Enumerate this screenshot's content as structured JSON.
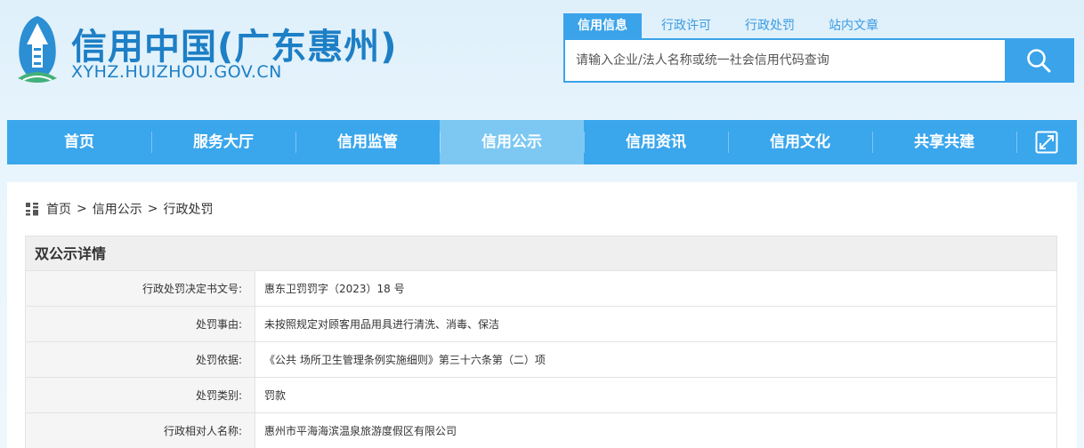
{
  "header": {
    "title": "信用中国(广东惠州)",
    "url": "XYHZ.HUIZHOU.GOV.CN"
  },
  "search": {
    "tabs": [
      {
        "label": "信用信息",
        "active": true
      },
      {
        "label": "行政许可",
        "active": false
      },
      {
        "label": "行政处罚",
        "active": false
      },
      {
        "label": "站内文章",
        "active": false
      }
    ],
    "placeholder": "请输入企业/法人名称或统一社会信用代码查询"
  },
  "nav": {
    "items": [
      {
        "label": "首页",
        "active": false
      },
      {
        "label": "服务大厅",
        "active": false
      },
      {
        "label": "信用监管",
        "active": false
      },
      {
        "label": "信用公示",
        "active": true
      },
      {
        "label": "信用资讯",
        "active": false
      },
      {
        "label": "信用文化",
        "active": false
      },
      {
        "label": "共享共建",
        "active": false
      }
    ]
  },
  "breadcrumb": {
    "home": "首页",
    "section": "信用公示",
    "current": "行政处罚",
    "separator": ">"
  },
  "panel": {
    "title": "双公示详情"
  },
  "details": [
    {
      "label": "行政处罚决定书文号:",
      "value": "惠东卫罚罚字（2023）18 号"
    },
    {
      "label": "处罚事由:",
      "value": "未按照规定对顾客用品用具进行清洗、消毒、保洁"
    },
    {
      "label": "处罚依据:",
      "value": "《公共 场所卫生管理条例实施细则》第三十六条第（二）项"
    },
    {
      "label": "处罚类别:",
      "value": "罚款"
    },
    {
      "label": "行政相对人名称:",
      "value": "惠州市平海海滨温泉旅游度假区有限公司"
    }
  ],
  "colors": {
    "brand": "#1d7fc6",
    "nav": "#3aa6ec",
    "nav_active": "#7cc8f2"
  },
  "icons": [
    "logo-tower-icon",
    "search-icon",
    "expand-icon",
    "sitemap-icon"
  ]
}
